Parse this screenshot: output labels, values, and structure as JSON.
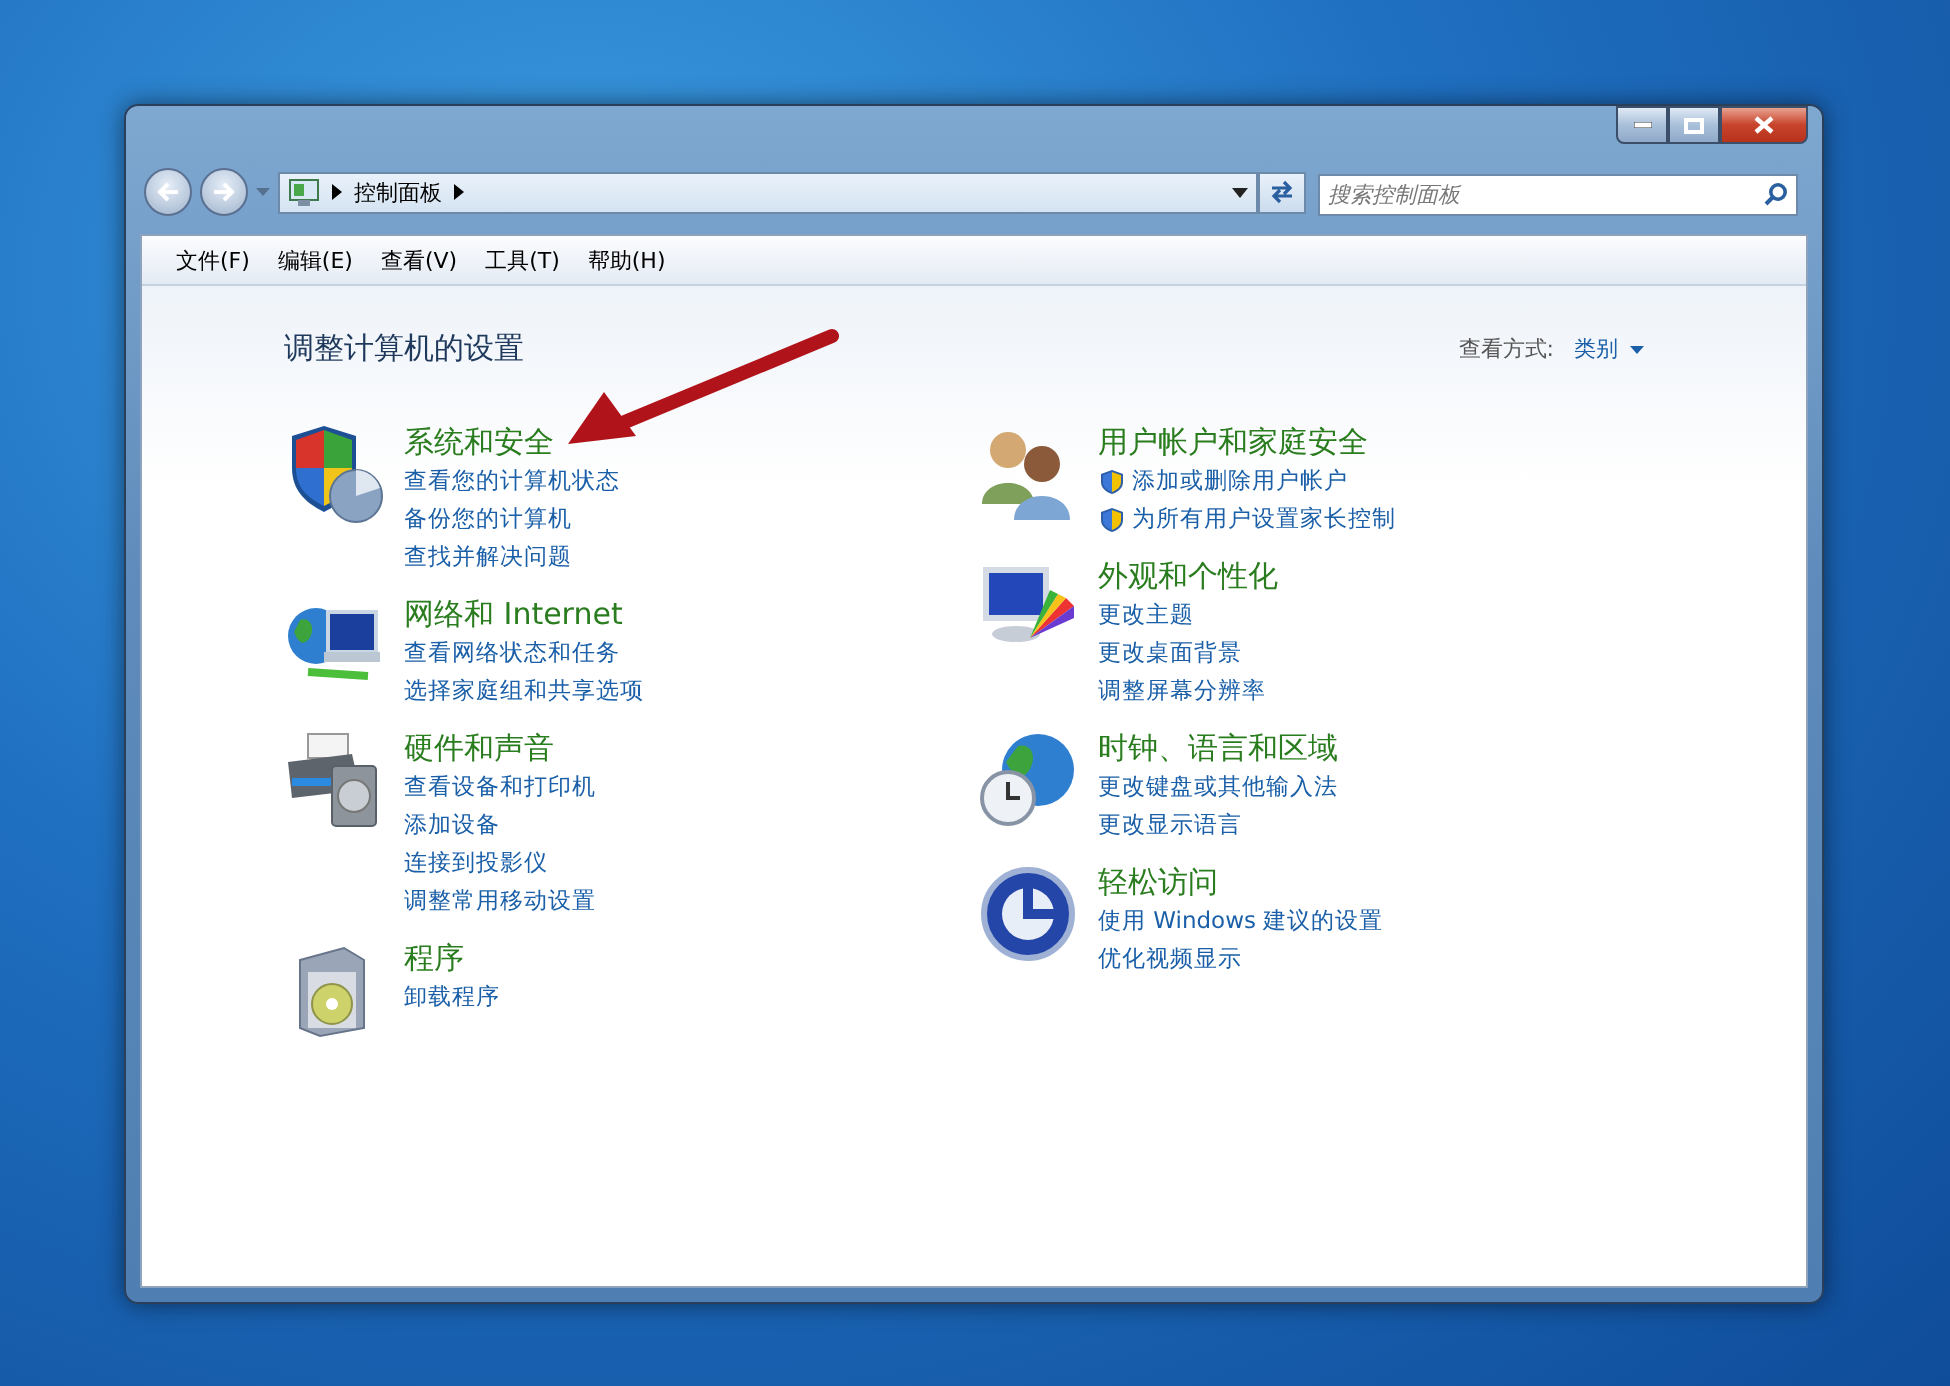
{
  "address_bar": {
    "crumbs": [
      "控制面板"
    ]
  },
  "search": {
    "placeholder": "搜索控制面板"
  },
  "menu_bar": [
    "文件(F)",
    "编辑(E)",
    "查看(V)",
    "工具(T)",
    "帮助(H)"
  ],
  "page_title": "调整计算机的设置",
  "view_by": {
    "label": "查看方式:",
    "value": "类别"
  },
  "columns": [
    [
      {
        "kind": "security",
        "title": "系统和安全",
        "links": [
          {
            "kind": "link",
            "text": "查看您的计算机状态"
          },
          {
            "kind": "link",
            "text": "备份您的计算机"
          },
          {
            "kind": "link",
            "text": "查找并解决问题"
          }
        ]
      },
      {
        "kind": "network",
        "title": "网络和 Internet",
        "links": [
          {
            "kind": "link",
            "text": "查看网络状态和任务"
          },
          {
            "kind": "link",
            "text": "选择家庭组和共享选项"
          }
        ]
      },
      {
        "kind": "hardware",
        "title": "硬件和声音",
        "links": [
          {
            "kind": "link",
            "text": "查看设备和打印机"
          },
          {
            "kind": "link",
            "text": "添加设备"
          },
          {
            "kind": "link",
            "text": "连接到投影仪"
          },
          {
            "kind": "link",
            "text": "调整常用移动设置"
          }
        ]
      },
      {
        "kind": "programs",
        "title": "程序",
        "links": [
          {
            "kind": "link",
            "text": "卸载程序"
          }
        ]
      }
    ],
    [
      {
        "kind": "users",
        "title": "用户帐户和家庭安全",
        "links": [
          {
            "kind": "shield",
            "text": "添加或删除用户帐户"
          },
          {
            "kind": "shield",
            "text": "为所有用户设置家长控制"
          }
        ]
      },
      {
        "kind": "appearance",
        "title": "外观和个性化",
        "links": [
          {
            "kind": "link",
            "text": "更改主题"
          },
          {
            "kind": "link",
            "text": "更改桌面背景"
          },
          {
            "kind": "link",
            "text": "调整屏幕分辨率"
          }
        ]
      },
      {
        "kind": "clock",
        "title": "时钟、语言和区域",
        "links": [
          {
            "kind": "link",
            "text": "更改键盘或其他输入法"
          },
          {
            "kind": "link",
            "text": "更改显示语言"
          }
        ]
      },
      {
        "kind": "access",
        "title": "轻松访问",
        "links": [
          {
            "kind": "link",
            "text": "使用 Windows 建议的设置"
          },
          {
            "kind": "link",
            "text": "优化视频显示"
          }
        ]
      }
    ]
  ]
}
